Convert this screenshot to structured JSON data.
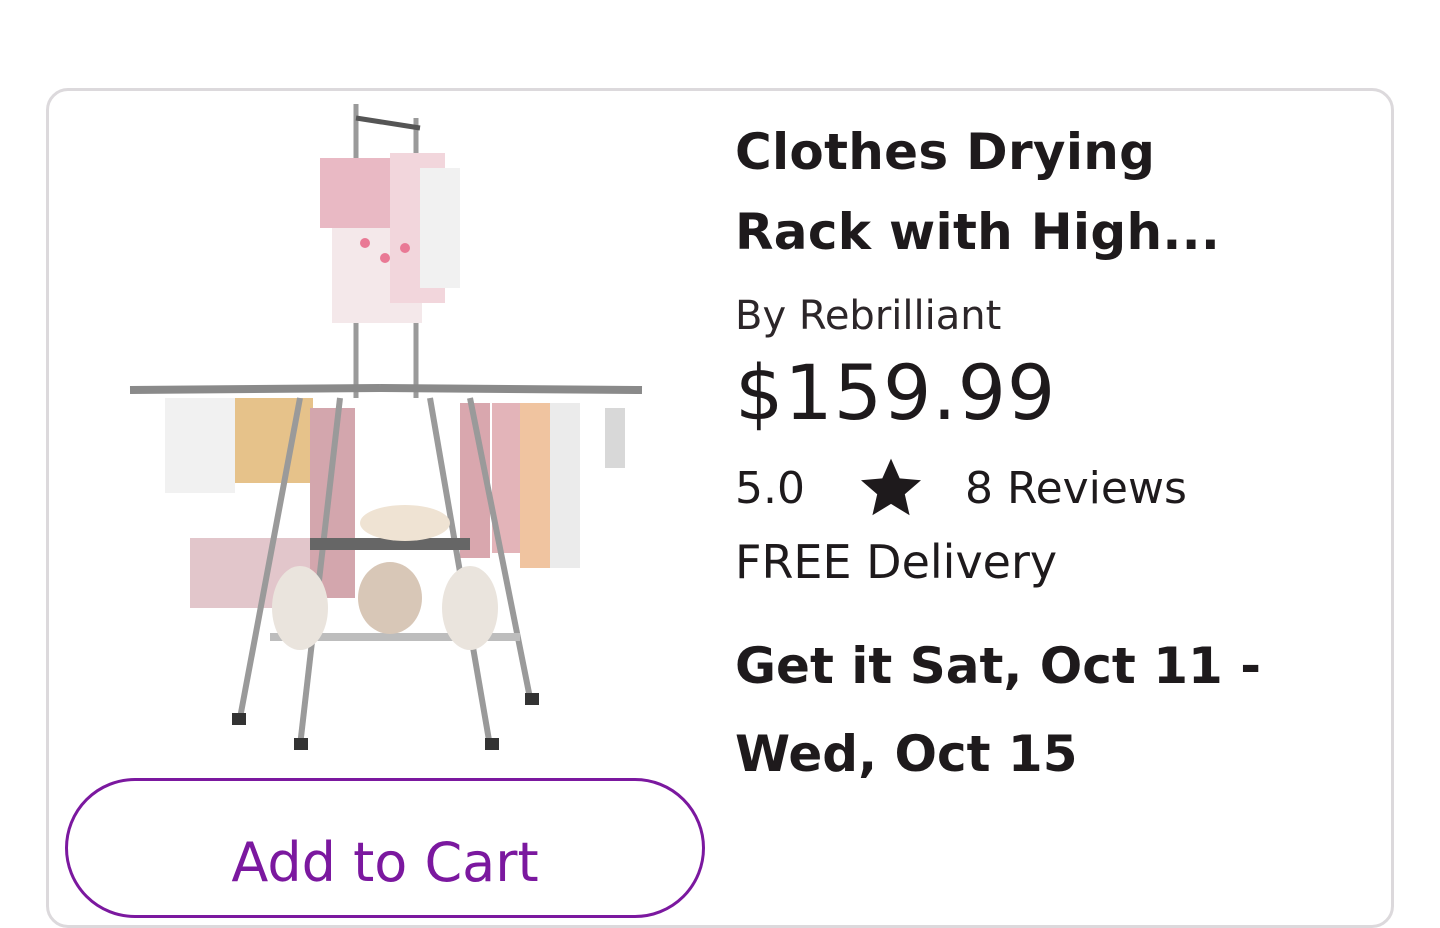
{
  "product": {
    "title": "Clothes Drying Rack with High...",
    "brand": "By Rebrilliant",
    "price": "$159.99",
    "rating": "5.0",
    "reviews": "8 Reviews",
    "delivery": "FREE Delivery",
    "delivery_date": "Get it Sat, Oct 11 - Wed, Oct 15",
    "image_icon": "clothes-drying-rack-image"
  },
  "actions": {
    "add_to_cart": "Add to Cart"
  },
  "colors": {
    "accent": "#7b189f",
    "text": "#1e1a1c",
    "border": "#dcd9dc"
  }
}
